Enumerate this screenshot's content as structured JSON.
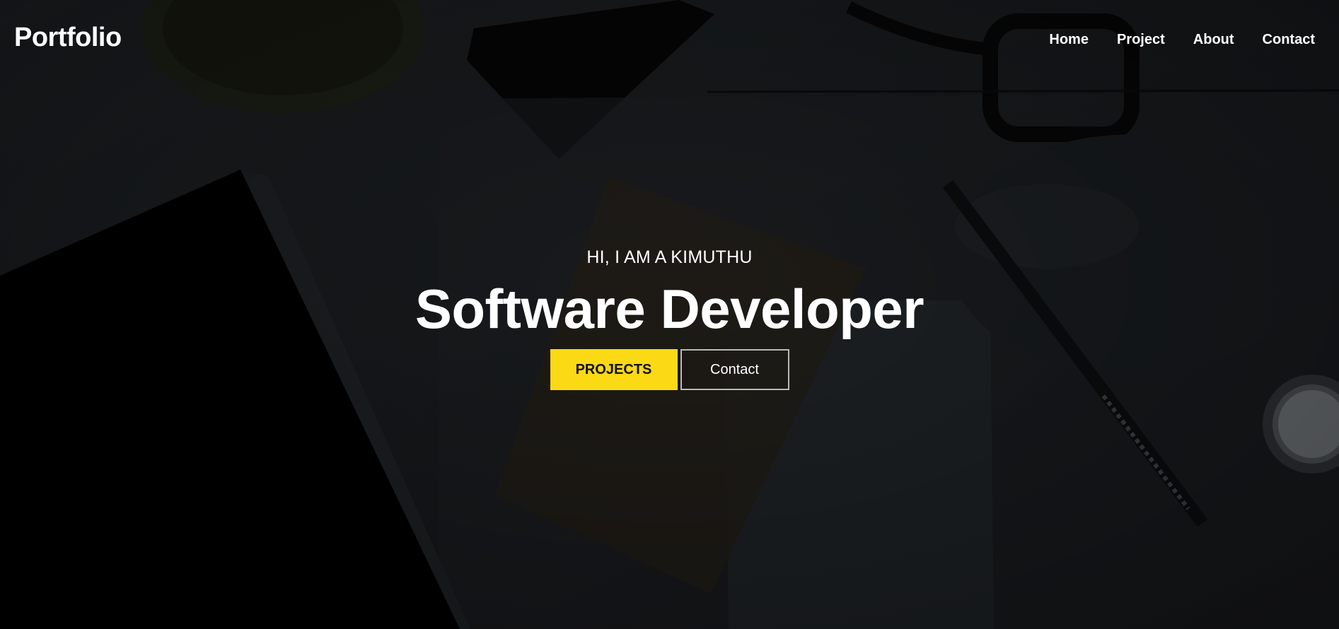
{
  "header": {
    "logo": "Portfolio",
    "nav": [
      "Home",
      "Project",
      "About",
      "Contact"
    ]
  },
  "hero": {
    "subtitle": "HI, I AM A KIMUTHU",
    "title": "Software Developer",
    "primary_button": "PROJECTS",
    "secondary_button": "Contact"
  },
  "colors": {
    "accent": "#fbd915",
    "text": "#ffffff",
    "background": "#15181b"
  }
}
